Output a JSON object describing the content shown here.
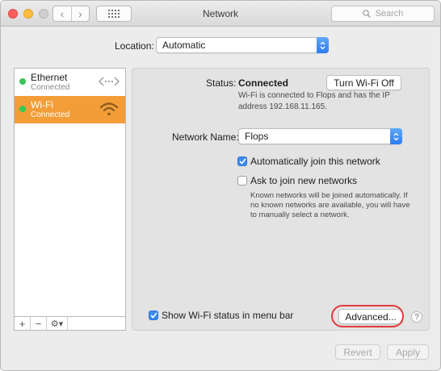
{
  "window": {
    "title": "Network"
  },
  "toolbar": {
    "back_label": "‹",
    "forward_label": "›",
    "search_placeholder": "Search"
  },
  "location": {
    "label": "Location:",
    "value": "Automatic"
  },
  "sidebar": {
    "items": [
      {
        "name": "Ethernet",
        "status": "Connected",
        "icon": "ethernet-icon",
        "selected": false
      },
      {
        "name": "Wi-Fi",
        "status": "Connected",
        "icon": "wifi-icon",
        "selected": true
      }
    ],
    "add_label": "+",
    "remove_label": "−",
    "actions_label": "⚙︎▾"
  },
  "detail": {
    "status_label": "Status:",
    "status_value": "Connected",
    "turn_off_button": "Turn Wi-Fi Off",
    "status_desc_line1": "Wi-Fi is connected to Flops and has the IP",
    "status_desc_line2": "address 192.168.11.165.",
    "network_name_label": "Network Name:",
    "network_name_value": "Flops",
    "auto_join_label": "Automatically join this network",
    "auto_join_checked": true,
    "ask_join_label": "Ask to join new networks",
    "ask_join_checked": false,
    "ask_join_desc_line1": "Known networks will be joined automatically. If",
    "ask_join_desc_line2": "no known networks are available, you will have",
    "ask_join_desc_line3": "to manually select a network.",
    "show_status_label": "Show Wi-Fi status in menu bar",
    "show_status_checked": true,
    "advanced_button": "Advanced...",
    "help_label": "?"
  },
  "footer": {
    "revert_button": "Revert",
    "apply_button": "Apply"
  },
  "colors": {
    "selection": "#f29d38",
    "accent": "#3a8bf4",
    "connected_dot": "#38c754",
    "annotation": "#e23b3b"
  }
}
